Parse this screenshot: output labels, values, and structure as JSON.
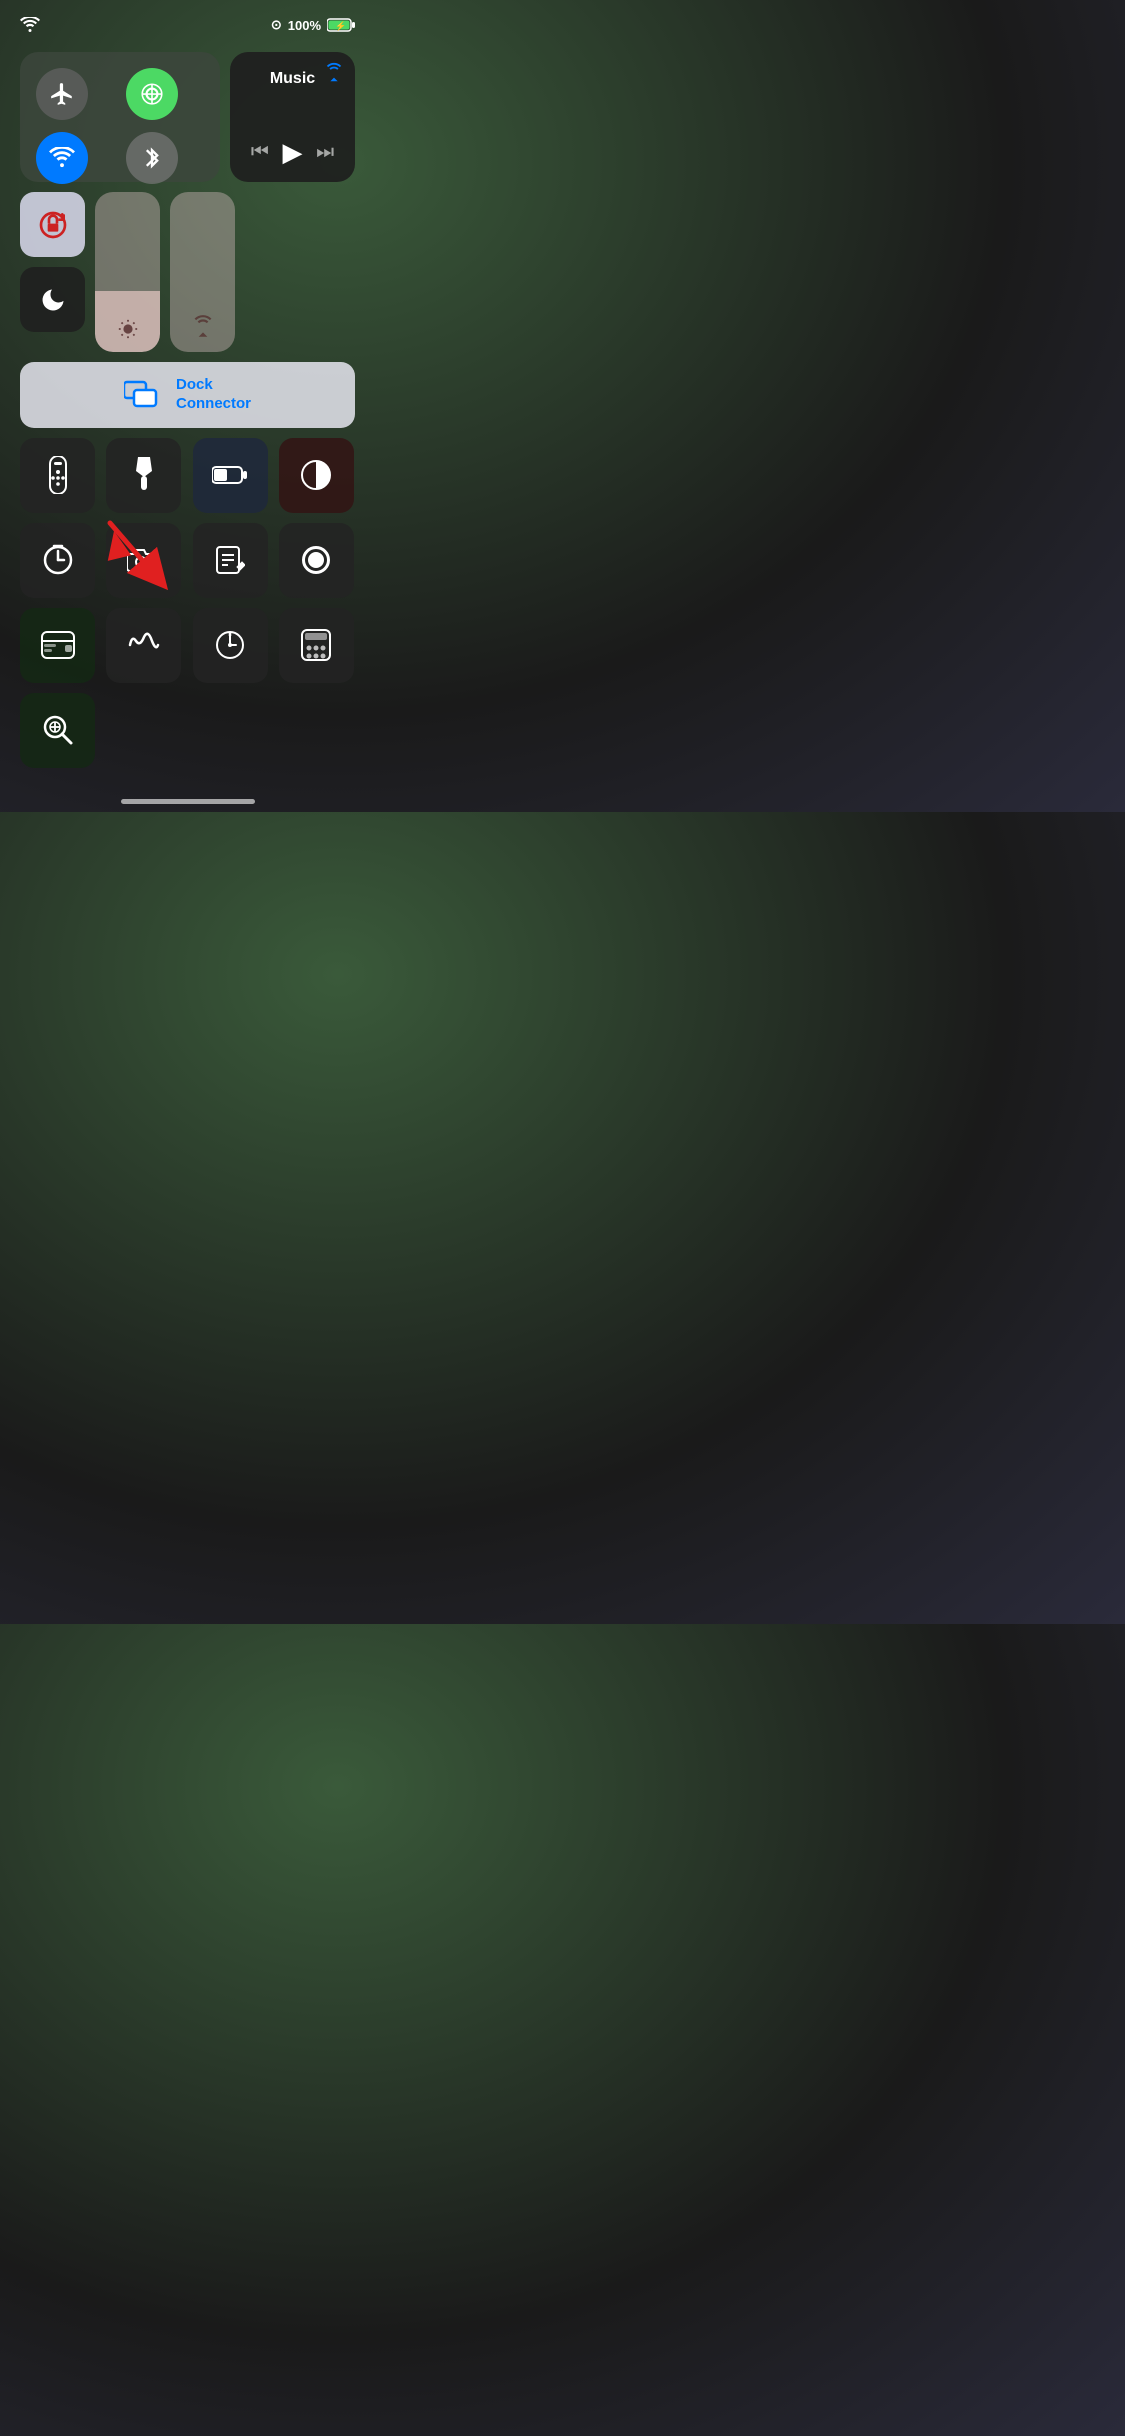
{
  "statusBar": {
    "battery": "100%",
    "wifiIcon": "wifi"
  },
  "musicPanel": {
    "title": "Music",
    "airplayIcon": "📡"
  },
  "networkButtons": {
    "airplane": "✈",
    "cellular": "((·))",
    "wifi": "wifi",
    "bluetooth": "bt"
  },
  "toggles": {
    "screenLock": "🔒",
    "doNotDisturb": "🌙"
  },
  "dockConnector": {
    "label": "Dock\nConnector"
  },
  "appRows": {
    "row1": [
      {
        "icon": "remote",
        "label": "Remote"
      },
      {
        "icon": "flashlight",
        "label": "Flashlight"
      },
      {
        "icon": "battery",
        "label": "Low Power"
      },
      {
        "icon": "contrast",
        "label": "Dark Mode"
      }
    ],
    "row2": [
      {
        "icon": "timer",
        "label": "Timer"
      },
      {
        "icon": "camera",
        "label": "Camera"
      },
      {
        "icon": "notes",
        "label": "Notes"
      },
      {
        "icon": "record",
        "label": "Screen Record"
      }
    ],
    "row3": [
      {
        "icon": "wallet",
        "label": "Wallet"
      },
      {
        "icon": "soundrecog",
        "label": "Sound Recognition"
      },
      {
        "icon": "clock",
        "label": "Clock"
      },
      {
        "icon": "calculator",
        "label": "Calculator"
      }
    ],
    "row4": [
      {
        "icon": "magnify",
        "label": "Magnifier"
      }
    ]
  }
}
